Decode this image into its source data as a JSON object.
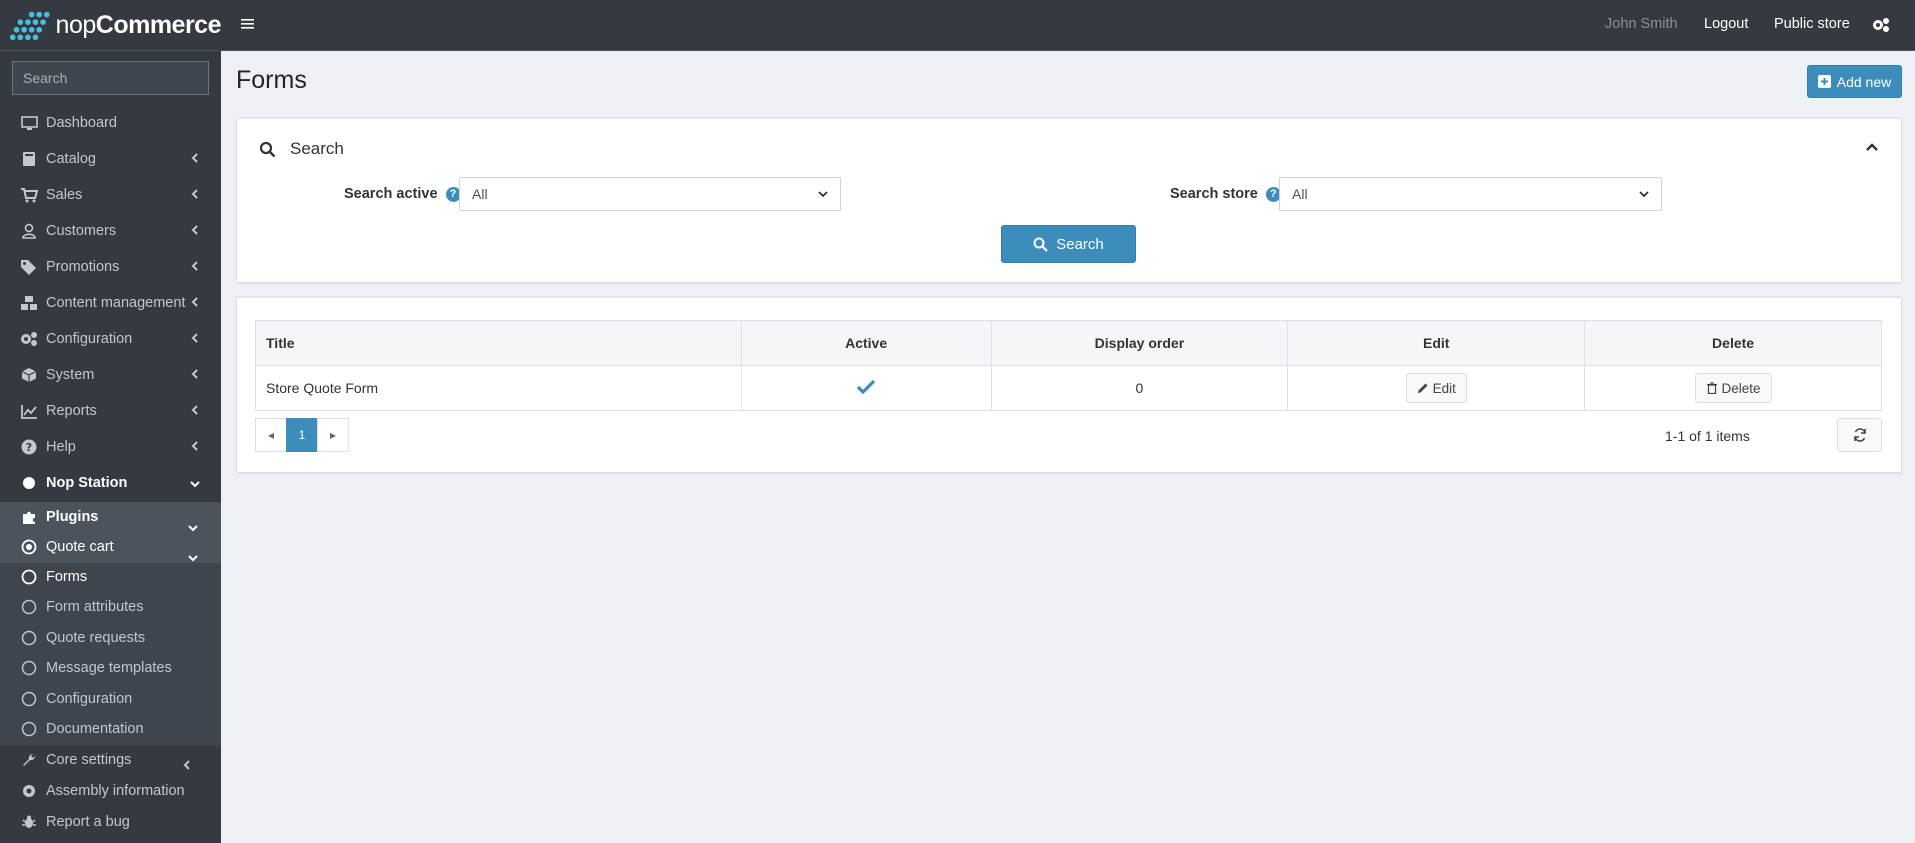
{
  "brand": {
    "name_light": "nop",
    "name_bold": "Commerce"
  },
  "sidebar": {
    "search_placeholder": "Search",
    "items": [
      {
        "label": "Dashboard",
        "icon": "monitor-icon"
      },
      {
        "label": "Catalog",
        "icon": "book-icon"
      },
      {
        "label": "Sales",
        "icon": "cart-icon"
      },
      {
        "label": "Customers",
        "icon": "user-icon"
      },
      {
        "label": "Promotions",
        "icon": "tags-icon"
      },
      {
        "label": "Content management",
        "icon": "cubes-icon"
      },
      {
        "label": "Configuration",
        "icon": "gears-icon"
      },
      {
        "label": "System",
        "icon": "cube-icon"
      },
      {
        "label": "Reports",
        "icon": "chart-icon"
      },
      {
        "label": "Help",
        "icon": "question-icon"
      },
      {
        "label": "Nop Station",
        "icon": "circle-icon"
      },
      {
        "label": "Plugins",
        "icon": "puzzle-icon"
      },
      {
        "label": "Quote cart",
        "icon": "dot-circle-icon"
      },
      {
        "label": "Forms",
        "icon": "circle-outline-icon"
      },
      {
        "label": "Form attributes",
        "icon": "circle-outline-icon"
      },
      {
        "label": "Quote requests",
        "icon": "circle-outline-icon"
      },
      {
        "label": "Message templates",
        "icon": "circle-outline-icon"
      },
      {
        "label": "Configuration",
        "icon": "circle-outline-icon"
      },
      {
        "label": "Documentation",
        "icon": "circle-outline-icon"
      },
      {
        "label": "Core settings",
        "icon": "wrench-icon"
      },
      {
        "label": "Assembly information",
        "icon": "gear-icon"
      },
      {
        "label": "Report a bug",
        "icon": "bug-icon"
      }
    ]
  },
  "header": {
    "user": "John Smith",
    "logout": "Logout",
    "public_store": "Public store"
  },
  "page": {
    "title": "Forms",
    "add_new": "Add new"
  },
  "search_panel": {
    "title": "Search",
    "active_label": "Search active",
    "active_value": "All",
    "store_label": "Search store",
    "store_value": "All",
    "button": "Search"
  },
  "grid": {
    "columns": [
      "Title",
      "Active",
      "Display order",
      "Edit",
      "Delete"
    ],
    "rows": [
      {
        "title": "Store Quote Form",
        "active": true,
        "display_order": "0",
        "edit": "Edit",
        "delete": "Delete"
      }
    ],
    "pager": {
      "current": "1",
      "summary": "1-1 of 1 items"
    }
  },
  "colors": {
    "accent": "#3c8dbc",
    "sidebar": "#343a40",
    "background": "#edf0f4"
  }
}
